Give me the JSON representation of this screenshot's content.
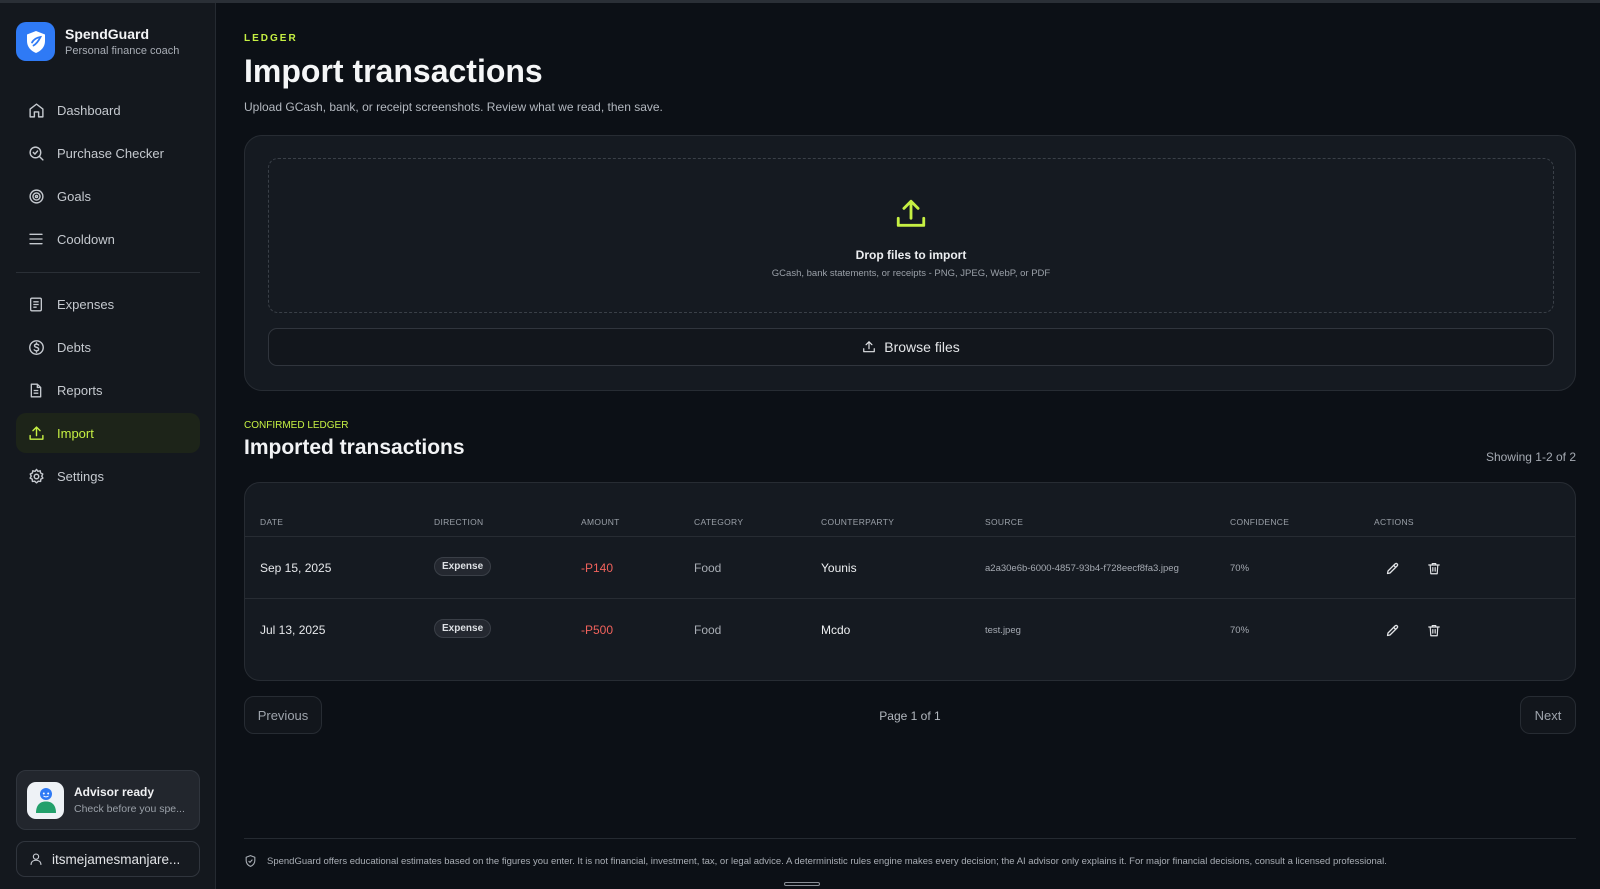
{
  "brand": {
    "name": "SpendGuard",
    "tagline": "Personal finance coach"
  },
  "sidebar": {
    "primary": [
      {
        "label": "Dashboard",
        "icon": "home-icon"
      },
      {
        "label": "Purchase Checker",
        "icon": "magnifier-check-icon"
      },
      {
        "label": "Goals",
        "icon": "target-icon"
      },
      {
        "label": "Cooldown",
        "icon": "menu-lines-icon"
      }
    ],
    "secondary": [
      {
        "label": "Expenses",
        "icon": "receipt-icon"
      },
      {
        "label": "Debts",
        "icon": "dollar-circle-icon"
      },
      {
        "label": "Reports",
        "icon": "document-icon"
      },
      {
        "label": "Import",
        "icon": "upload-icon",
        "active": true
      },
      {
        "label": "Settings",
        "icon": "gear-icon"
      }
    ],
    "advisor": {
      "title": "Advisor ready",
      "subtitle": "Check before you spe..."
    },
    "user": {
      "name": "itsmejamesmanjare..."
    }
  },
  "header": {
    "eyebrow": "LEDGER",
    "title": "Import transactions",
    "subtitle": "Upload GCash, bank, or receipt screenshots. Review what we read, then save."
  },
  "upload": {
    "drop_title": "Drop files to import",
    "drop_subtitle": "GCash, bank statements, or receipts - PNG, JPEG, WebP, or PDF",
    "browse_label": "Browse files"
  },
  "ledger": {
    "eyebrow": "CONFIRMED LEDGER",
    "title": "Imported transactions",
    "showing": "Showing 1-2 of 2",
    "columns": [
      "DATE",
      "DIRECTION",
      "AMOUNT",
      "CATEGORY",
      "COUNTERPARTY",
      "SOURCE",
      "CONFIDENCE",
      "ACTIONS"
    ],
    "rows": [
      {
        "date": "Sep 15, 2025",
        "direction": "Expense",
        "amount": "-P140",
        "category": "Food",
        "counterparty": "Younis",
        "source": "a2a30e6b-6000-4857-93b4-f728eecf8fa3.jpeg",
        "confidence": "70%"
      },
      {
        "date": "Jul 13, 2025",
        "direction": "Expense",
        "amount": "-P500",
        "category": "Food",
        "counterparty": "Mcdo",
        "source": "test.jpeg",
        "confidence": "70%"
      }
    ]
  },
  "pagination": {
    "previous": "Previous",
    "page": "Page 1 of 1",
    "next": "Next"
  },
  "footer": {
    "disclaimer": "SpendGuard offers educational estimates based on the figures you enter. It is not financial, investment, tax, or legal advice. A deterministic rules engine makes every decision; the AI advisor only explains it. For major financial decisions, consult a licensed professional."
  },
  "colors": {
    "accent": "#c6f043",
    "brand": "#2f7af5",
    "negative": "#f0625c",
    "background": "#0c1016"
  }
}
